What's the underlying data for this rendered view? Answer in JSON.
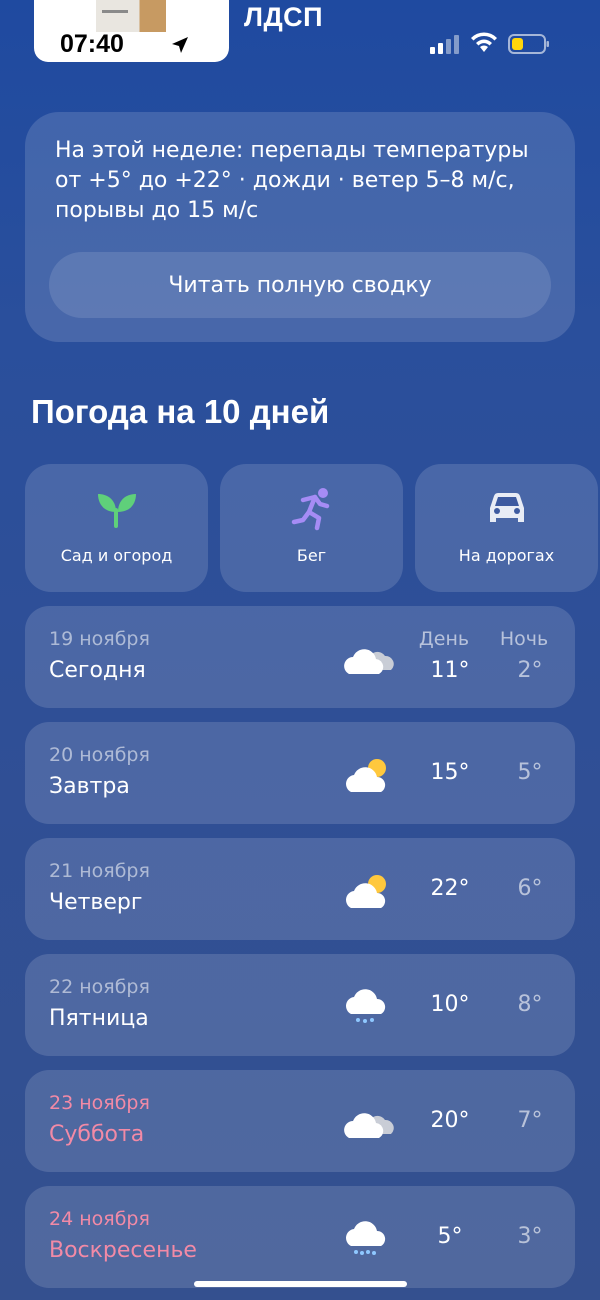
{
  "status_bar": {
    "time": "07:40",
    "top_label": "ЛДСП"
  },
  "summary": {
    "text": "На этой неделе: перепады температуры от +5° до +22° · дожди · ветер 5–8 м/с, порывы до 15 м/с",
    "button_label": "Читать полную сводку"
  },
  "forecast_title": "Погода на 10 дней",
  "activities": [
    {
      "label": "Сад и огород",
      "icon": "sprout-icon"
    },
    {
      "label": "Бег",
      "icon": "running-icon"
    },
    {
      "label": "На дорогах",
      "icon": "car-icon"
    }
  ],
  "column_headers": {
    "day": "День",
    "night": "Ночь"
  },
  "days": [
    {
      "date": "19 ноября",
      "name": "Сегодня",
      "icon": "cloudy-icon",
      "day_temp": "11°",
      "night_temp": "2°"
    },
    {
      "date": "20 ноября",
      "name": "Завтра",
      "icon": "partly-cloudy-icon",
      "day_temp": "15°",
      "night_temp": "5°"
    },
    {
      "date": "21 ноября",
      "name": "Четверг",
      "icon": "partly-cloudy-icon",
      "day_temp": "22°",
      "night_temp": "6°"
    },
    {
      "date": "22 ноября",
      "name": "Пятница",
      "icon": "rain-icon",
      "day_temp": "10°",
      "night_temp": "8°"
    },
    {
      "date": "23 ноября",
      "name": "Суббота",
      "icon": "cloudy-icon",
      "day_temp": "20°",
      "night_temp": "7°"
    },
    {
      "date": "24 ноября",
      "name": "Воскресенье",
      "icon": "rain-icon",
      "day_temp": "5°",
      "night_temp": "3°"
    }
  ],
  "colors": {
    "weekend": "#f28aa6",
    "background": "#2a4f9c"
  }
}
